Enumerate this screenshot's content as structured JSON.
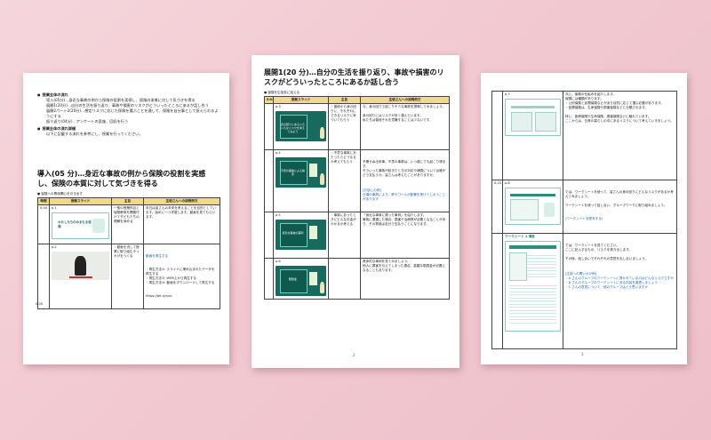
{
  "page1": {
    "bullets": [
      {
        "label": "授業全体の流れ",
        "items": [
          "導入(05分)…身近な事故の例から保険の役割を実感し、保険の本質に対して気づきを得る",
          "展開1(20分)…自分の生活を振り返り、事故や損害のリスクがどういったところにあるか話し合う",
          "展開2パート2(20分)…想定リスクに応じた保険を選ぶことを通して、保険を自分事として捉えられるようにする",
          "振り返り(04分)…アンケートの実施、回収を行う"
        ]
      },
      {
        "label": "授業全体の流れ詳細",
        "items": [
          "以下に記載する流れを参考にし、授業を行ってください。"
        ]
      }
    ],
    "heading": "導入(05 分)…身近な事故の例から保険の役割を実感し、保険の本質に対して気づきを得る",
    "table_caption": "● 保険への興味関心を引き出す",
    "columns": [
      "時間",
      "授業スライド",
      "主旨",
      "生徒さんへの説明例文"
    ],
    "rows": [
      {
        "time": "0:00",
        "slide_no": "p.1",
        "slide_title": "わたしたちのみまもる保険",
        "purpose": "一般の授業科目と保険教育を関連付けて子どもたちの理解を深める",
        "text": "本日は皆さんの未来を考えることを目的としています。始めに一つ学習します。動画を見てもらいます。",
        "blue": ""
      },
      {
        "time": "",
        "slide_no": "p.2",
        "slide_title": "",
        "purpose": "・動画を流して授業に取り組むきっかけをつくる",
        "text": "・再生方法①: スライドに埋め込まれたデータを再生する\n・再生方法②: WEB上から再生する\n・再生方法③: 動画をダウンロードして再生する",
        "blue": "動画を再生する"
      }
    ],
    "link": "https://bit.ly/xxx",
    "footer_time": "0:05",
    "page_number": ""
  },
  "page2": {
    "heading": "展開1(20 分)…自分の生活を振り返り、事故や損害のリスクがどういったところにあるか話し合う",
    "table_caption": "● 保険を生徒役に話える",
    "columns": [
      "授業スライド",
      "主旨",
      "生徒さんへの説明例文"
    ],
    "time_start": "0:05",
    "rows": [
      {
        "slide_no": "p.3",
        "slide_title": "身の回りにあるいろいろなリスクを考えてみよう",
        "purpose": "・普段から身の回りに、それぞれにできるリスクに気づいてもらう",
        "text": "今、身の回りで起こりそうな事故を想像してみましょう。\n\n身の回りにはリスクが多く潜んでいます。\n私たちは普段それを意識することは少ないです。",
        "blue": ""
      },
      {
        "slide_no": "p.4",
        "slide_title": "不意の事故による損害",
        "purpose": "・不意な事故にあたったらどうなるか考えてもらう",
        "text": "予期せぬ出来事、不意の事故は、いつ誰にでも起こり得ます。\nそういった事故が起きたときの対応や補償については誰がどう支払うか、皆さんは考えたことがありますか。",
        "blue": "[お話しの例]\n日頃の事故により、夢やゴールが影響を受けてしまうことがあります"
      },
      {
        "slide_no": "p.5",
        "slide_title": "身近な事故の事例",
        "purpose": "・事故にあったときにどんなお金がかかるか考える",
        "text": "「身近な事故に遭った事例」を紹介します。\n事故に遭遇した場合、損害や治療費が必要となることがあり、その費用は自分で支払うことになります。",
        "blue": ""
      },
      {
        "slide_no": "p.6",
        "slide_title": "賠償金",
        "purpose": "",
        "text": "具体的な事例を見てみましょう。\n他人に損害を与えてしまった場合、高額な賠償金が必要になることもあります。",
        "blue": ""
      }
    ],
    "page_number": "2"
  },
  "page3": {
    "rows": [
      {
        "slide_no": "p.7",
        "time": "",
        "text": "次に、保険の仕組みを紹介します。\n保険には種類があります。\n・公的保険と民間保険などがあり目的に応じて選ぶ必要があります。\n・民間保険は、生命保険や損害保険などに分類されます。\n\n特に、医療保険や生命保険、損害保険などに触れています。\nここからは、日常の暮らしの中にあるリスクについて考えていきましょう。",
        "blue": ""
      },
      {
        "slide_no": "p.8",
        "time": "0:25",
        "text": "では、ワークシートを使って、皆さんの身の回りにどんなリスクがあるか考えてみましょう。\n\nワークシートを使って話し合い、グループワークに取り組みましょう。",
        "blue": "(ワークシートを配布する)"
      },
      {
        "slide_no": "ワークシート 1 項目",
        "time": "",
        "text": "では、ワークシートを見てください。\nここに記入するもの、リスクを書き出します。\n\nその後、話し合いでそれぞれの意見を出し合いましょう。",
        "blue": "[生徒への問いかけ例]\n・A さんのグループのワークシートに書かれているのはどんなリスクですか\n・B さんのグループのワークシートにある内容を発表しましょう\n・C さんの意見について、他のグループはどう思いますか"
      }
    ],
    "page_number": "3"
  }
}
